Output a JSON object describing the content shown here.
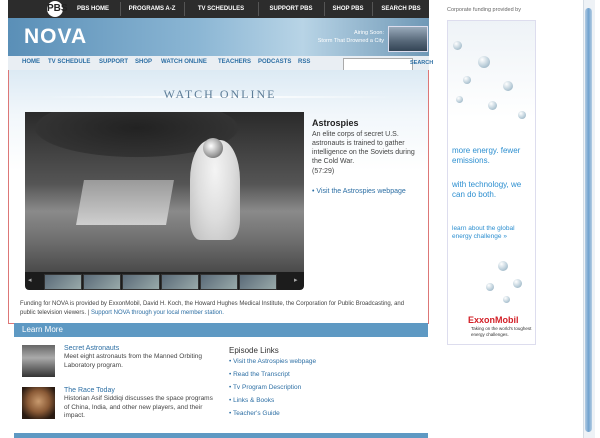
{
  "pbs_bar": {
    "logo": "PBS",
    "links": [
      "PBS HOME",
      "PROGRAMS A-Z",
      "TV SCHEDULES",
      "SUPPORT PBS",
      "SHOP PBS",
      "SEARCH PBS"
    ]
  },
  "header": {
    "logo": "NOVA",
    "airing_label": "Airing Soon:",
    "airing_title": "Storm That Drowned a City"
  },
  "nav": {
    "links": [
      "HOME",
      "TV SCHEDULE",
      "SUPPORT",
      "SHOP",
      "WATCH ONLINE",
      "TEACHERS",
      "PODCASTS",
      "RSS"
    ],
    "search_placeholder": "",
    "search_button": "SEARCH"
  },
  "watch": {
    "title": "WATCH ONLINE",
    "episode_title": "Astrospies",
    "episode_desc": "An elite corps of secret U.S. astronauts is trained to gather intelligence on the Soviets during the Cold War.",
    "duration": "(57:29)",
    "episode_link": "• Visit the Astrospies webpage",
    "funding_text": "Funding for NOVA is provided by ExxonMobil, David H. Koch, the Howard Hughes Medical Institute, the Corporation for Public Broadcasting, and public television viewers.",
    "funding_link": "Support NOVA through your local member station."
  },
  "learn_more": {
    "title": "Learn More",
    "items": [
      {
        "title": "Secret Astronauts",
        "desc": "Meet eight astronauts from the Manned Orbiting Laboratory program."
      },
      {
        "title": "The Race Today",
        "desc": "Historian Asif Siddiqi discusses the space programs of China, India, and other new players, and their impact."
      }
    ],
    "episode_links_title": "Episode Links",
    "episode_links": [
      "• Visit the Astrospies webpage",
      "• Read the Transcript",
      "• Tv Program Description",
      "• Links & Books",
      "• Teacher's Guide"
    ]
  },
  "sidebar": {
    "funding_label": "Corporate funding provided by",
    "ad_line1": "more energy. fewer emissions.",
    "ad_line2": "with technology, we can do both.",
    "ad_line3": "learn about the global energy challenge »",
    "ad_logo": "ExxonMobil",
    "ad_tagline": "Taking on the world's toughest energy challenges."
  }
}
